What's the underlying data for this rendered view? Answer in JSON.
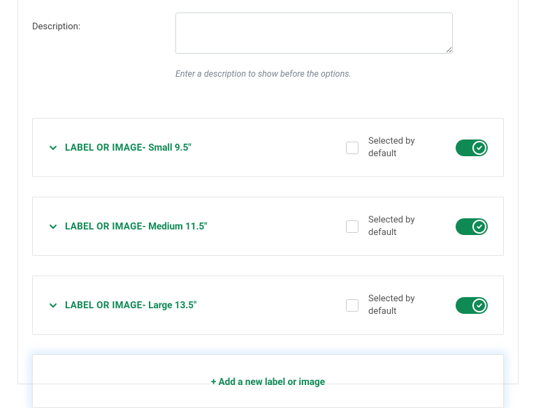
{
  "description": {
    "label": "Description:",
    "value": "",
    "placeholder": "",
    "helper": "Enter a description to show before the options."
  },
  "option_prefix": "LABEL OR IMAGE",
  "selected_label": "Selected by default",
  "items": [
    {
      "suffix": " - Small 9.5\"",
      "checked": false,
      "enabled": true
    },
    {
      "suffix": " - Medium 11.5\"",
      "checked": false,
      "enabled": true
    },
    {
      "suffix": " - Large 13.5\"",
      "checked": false,
      "enabled": true
    }
  ],
  "add_button_label": "+ Add a new label or image",
  "colors": {
    "accent": "#0f8a55"
  }
}
